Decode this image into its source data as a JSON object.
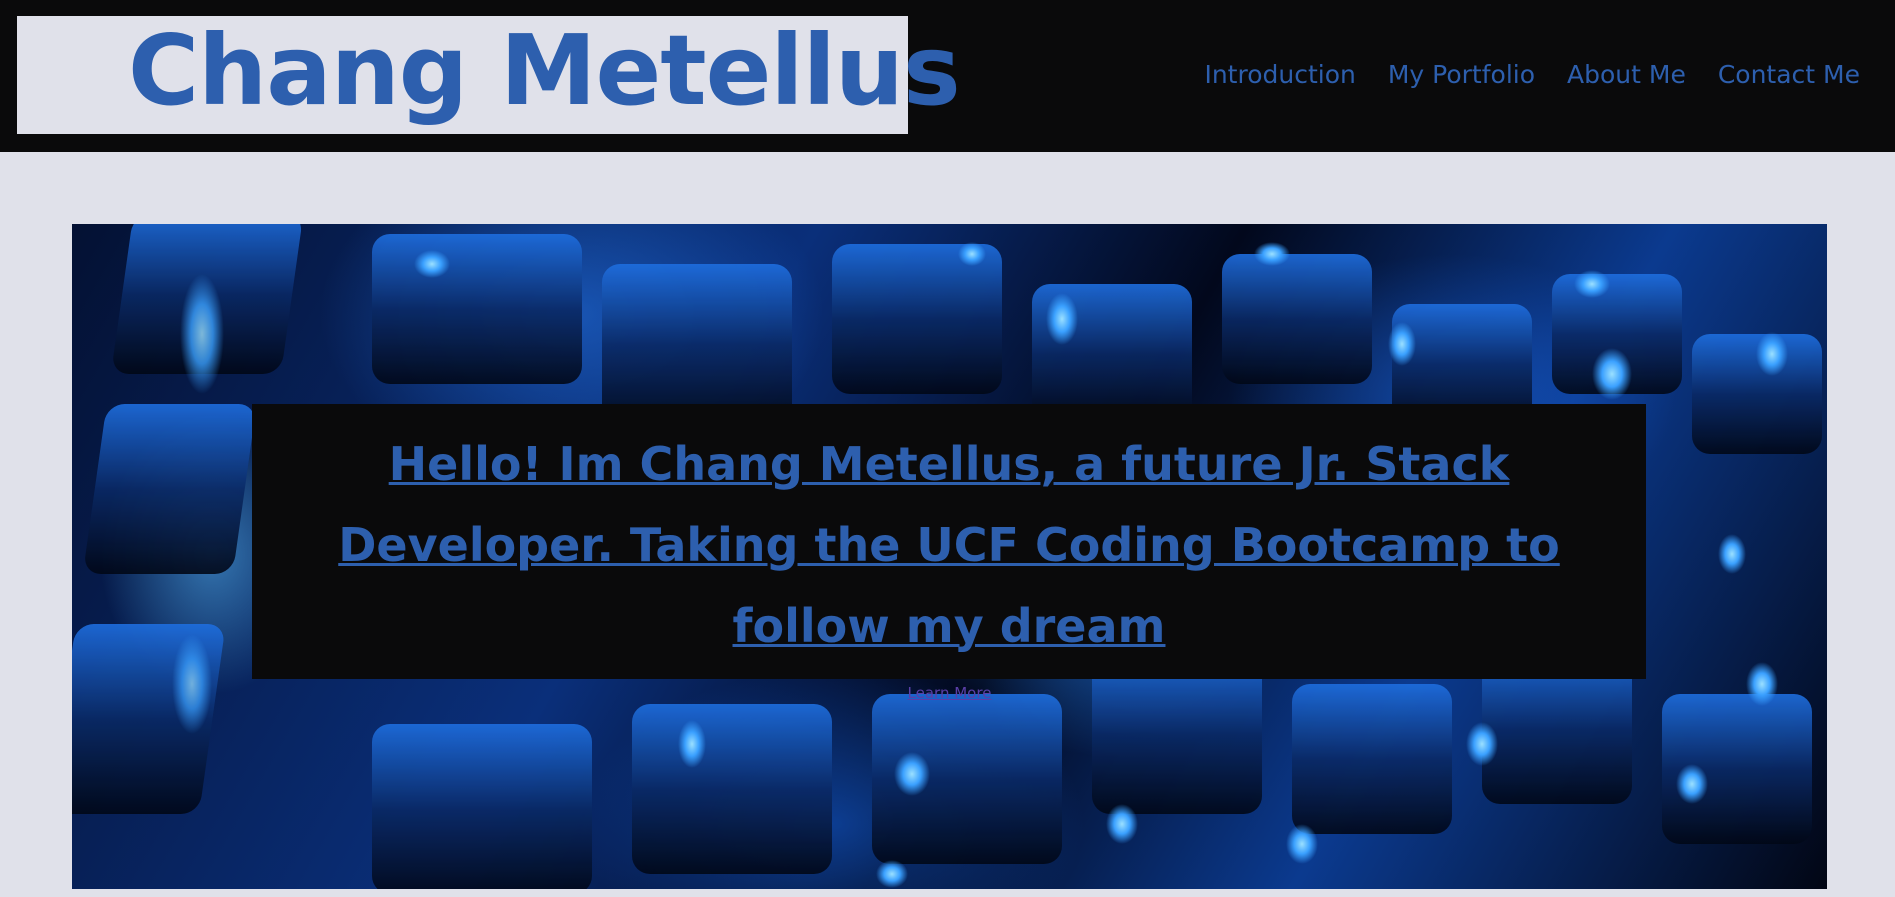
{
  "header": {
    "logo_text": "Chang Metellus",
    "nav": [
      {
        "label": "Introduction"
      },
      {
        "label": "My Portfolio"
      },
      {
        "label": "About Me"
      },
      {
        "label": "Contact Me"
      }
    ]
  },
  "hero": {
    "background_icon": "blue-backlit-keyboard-image",
    "heading": "Hello! Im Chang Metellus, a future Jr. Stack Developer. Taking the UCF Coding Bootcamp to follow my dream",
    "learn_more_label": "Learn More"
  },
  "colors": {
    "accent": "#2d5fae",
    "header_bg": "#0a0a0b",
    "page_bg": "#e0e1ea",
    "visited_link": "#5a3fa8"
  }
}
